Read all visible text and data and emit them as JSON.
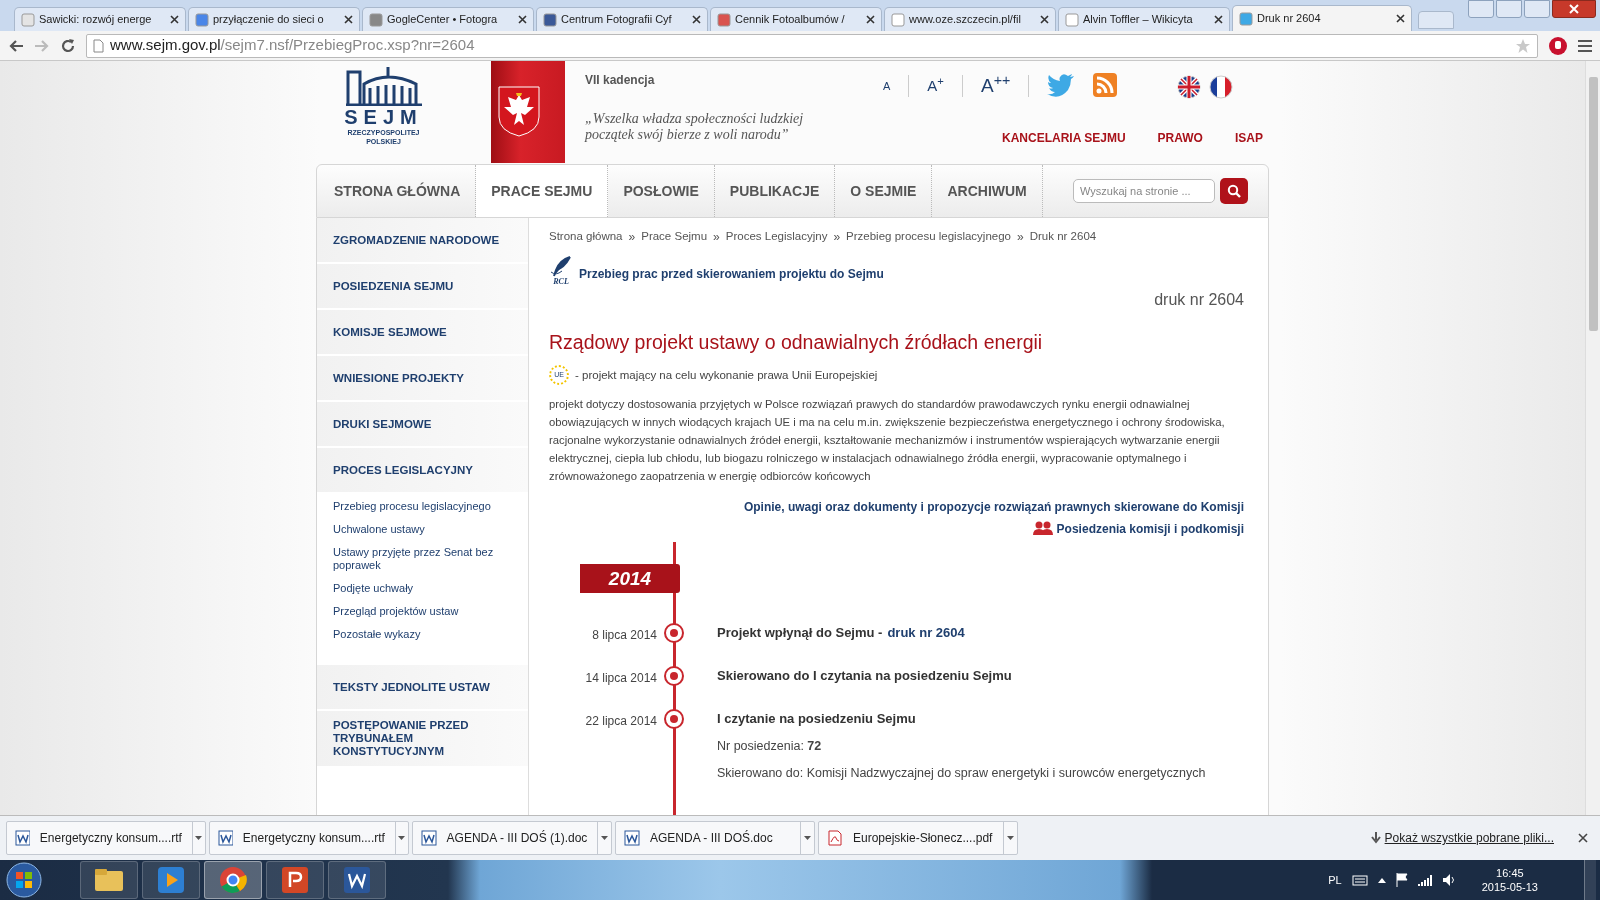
{
  "browser": {
    "tabs": [
      {
        "label": "Sawicki: rozwój energe",
        "selected": false
      },
      {
        "label": "przyłączenie do sieci o",
        "selected": false
      },
      {
        "label": "GogleCenter • Fotogra",
        "selected": false
      },
      {
        "label": "Centrum Fotografii Cyf",
        "selected": false
      },
      {
        "label": "Cennik Fotoalbumów /",
        "selected": false
      },
      {
        "label": "www.oze.szczecin.pl/fil",
        "selected": false
      },
      {
        "label": "Alvin Toffler – Wikicyta",
        "selected": false
      },
      {
        "label": "Druk nr 2604",
        "selected": true
      }
    ],
    "url_host": "www.sejm.gov.pl",
    "url_path": "/sejm7.nsf/PrzebiegProc.xsp?nr=2604"
  },
  "header": {
    "logo_word": "SEJM",
    "logo_sub": [
      "RZECZYPOSPOLITEJ",
      "POLSKIEJ"
    ],
    "term": "VII kadencja",
    "motto": [
      "„Wszelka władza społeczności ludzkiej",
      "początek swój bierze z woli narodu”"
    ],
    "font_sizes": [
      "A",
      "A$^{+}$",
      "A$^{++}$"
    ],
    "links": [
      "KANCELARIA SEJMU",
      "PRAWO",
      "ISAP"
    ]
  },
  "nav": {
    "items": [
      {
        "label": "STRONA GŁÓWNA",
        "selected": false
      },
      {
        "label": "PRACE SEJMU",
        "selected": true
      },
      {
        "label": "POSŁOWIE",
        "selected": false
      },
      {
        "label": "PUBLIKACJE",
        "selected": false
      },
      {
        "label": "O SEJMIE",
        "selected": false
      },
      {
        "label": "ARCHIWUM",
        "selected": false
      }
    ],
    "search_placeholder": "Wyszukaj na stronie ..."
  },
  "sidebar": {
    "items": [
      {
        "label": "ZGROMADZENIE NARODOWE"
      },
      {
        "label": "POSIEDZENIA SEJMU"
      },
      {
        "label": "KOMISJE SEJMOWE"
      },
      {
        "label": "WNIESIONE PROJEKTY"
      },
      {
        "label": "DRUKI SEJMOWE"
      },
      {
        "label": "PROCES LEGISLACYJNY",
        "children": [
          "Przebieg procesu legislacyjnego",
          "Uchwalone ustawy",
          "Ustawy przyjęte przez Senat bez poprawek",
          "Podjęte uchwały",
          "Przegląd projektów ustaw",
          "Pozostałe wykazy"
        ]
      },
      {
        "label": "TEKSTY JEDNOLITE USTAW"
      },
      {
        "label": "POSTĘPOWANIE PRZED TRYBUNAŁEM KONSTYTUCYJNYM"
      }
    ]
  },
  "content": {
    "breadcrumb_separator": "»",
    "breadcrumb": [
      "Strona główna",
      "Prace Sejmu",
      "Proces Legislacyjny",
      "Przebieg procesu legislacyjnego",
      "Druk nr 2604"
    ],
    "rcl_badge": "RCL",
    "rcl_link": "Przebieg prac przed skierowaniem projektu do Sejmu",
    "print_no": "druk nr 2604",
    "title": "Rządowy projekt ustawy o odnawialnych źródłach energii",
    "eu_badge": "UE",
    "eu_note": "- projekt mający na celu wykonanie prawa Unii Europejskiej",
    "description": "projekt dotyczy dostosowania przyjętych w Polsce rozwiązań prawych do standardów prawodawczych rynku energii odnawialnej obowiązujących w innych wiodących krajach UE i ma na celu m.in. zwiększenie bezpieczeństwa energetycznego i ochrony środowiska, racjonalne wykorzystanie odnawialnych źródeł energii, kształtowanie mechanizmów i instrumentów wspierających wytwarzanie energii elektrycznej, ciepła lub chłodu, lub biogazu rolniczego w instalacjach odnawialnego źródła energii, wypracowanie optymalnego i zrównoważonego zaopatrzenia w energię odbiorców końcowych",
    "opinions_link": "Opinie, uwagi oraz dokumenty i propozycje rozwiązań prawnych skierowane do Komisji",
    "committee_link": "Posiedzenia komisji i podkomisji",
    "timeline": {
      "year": "2014",
      "events": [
        {
          "date": "8 lipca 2014",
          "title": "Projekt wpłynął do Sejmu -",
          "link": "druk nr 2604"
        },
        {
          "date": "14 lipca 2014",
          "title": "Skierowano do I czytania na posiedzeniu Sejmu"
        },
        {
          "date": "22 lipca 2014",
          "title": "I czytanie na posiedzeniu Sejmu",
          "details": [
            "Nr posiedzenia: **72**",
            "Skierowano do: Komisji Nadzwyczajnej do spraw energetyki i surowców energetycznych"
          ]
        }
      ]
    }
  },
  "downloads": {
    "items": [
      {
        "name": "Energetyczny konsum....rtf",
        "kind": "word"
      },
      {
        "name": "Energetyczny konsum....rtf",
        "kind": "word"
      },
      {
        "name": "AGENDA - III DOŚ (1).doc",
        "kind": "word"
      },
      {
        "name": "AGENDA - III DOŚ.doc",
        "kind": "word"
      },
      {
        "name": "Europejskie-Słonecz....pdf",
        "kind": "pdf"
      }
    ],
    "show_all": "Pokaż wszystkie pobrane pliki..."
  },
  "taskbar": {
    "language": "PL",
    "time": "16:45",
    "date": "2015-05-13"
  }
}
